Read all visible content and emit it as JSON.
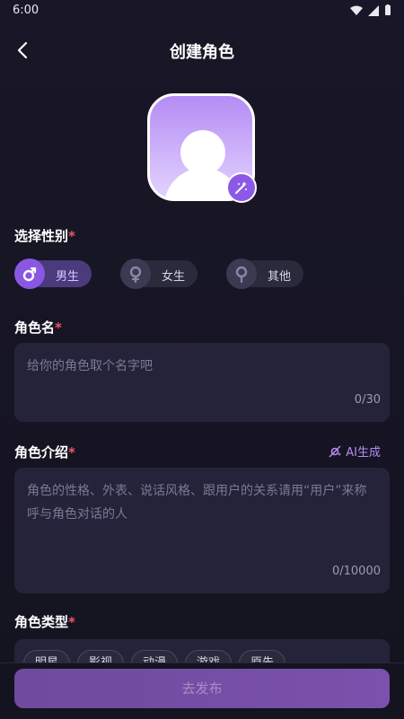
{
  "status": {
    "time": "6:00"
  },
  "header": {
    "title": "创建角色"
  },
  "gender": {
    "label": "选择性别",
    "required": "*",
    "options": [
      {
        "label": "男生",
        "selected": true,
        "icon": "male-icon"
      },
      {
        "label": "女生",
        "selected": false,
        "icon": "female-icon"
      },
      {
        "label": "其他",
        "selected": false,
        "icon": "other-gender-icon"
      }
    ]
  },
  "name": {
    "label": "角色名",
    "required": "*",
    "placeholder": "给你的角色取个名字吧",
    "counter": "0/30"
  },
  "intro": {
    "label": "角色介绍",
    "required": "*",
    "ai_label": "AI生成",
    "placeholder": "角色的性格、外表、说话风格、跟用户的关系请用“用户”来称呼与角色对话的人",
    "counter": "0/10000"
  },
  "type": {
    "label": "角色类型",
    "required": "*",
    "chips": [
      "明星",
      "影视",
      "动漫",
      "游戏",
      "原先"
    ]
  },
  "publish": {
    "label": "去发布"
  },
  "colors": {
    "accent": "#8a57e3",
    "background": "#191727",
    "card": "#24233a",
    "required": "#f2546a"
  }
}
